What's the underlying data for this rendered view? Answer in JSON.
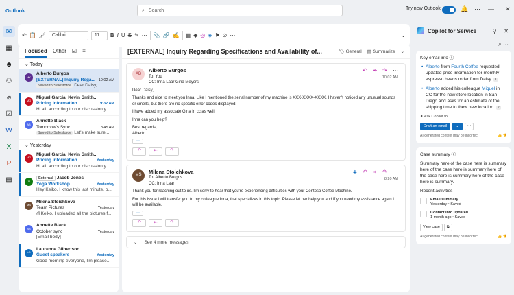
{
  "app": {
    "title": "Outlook"
  },
  "search": {
    "placeholder": "Search"
  },
  "titlebar": {
    "try_new": "Try new Outlook"
  },
  "ribbon": {
    "font": "Calibri",
    "size": "11"
  },
  "list": {
    "tabs": {
      "focused": "Focused",
      "other": "Other"
    },
    "groups": {
      "today": "Today",
      "yesterday": "Yesterday"
    },
    "items": [
      {
        "sender": "Alberto Burgos",
        "subject": "[EXTERNAL] Inquiry Rega...",
        "time": "10:02 AM",
        "chip": "Saved to Salesforce",
        "preview": "Dear Daisy,...",
        "initials": "MK",
        "color": "#5b2e91"
      },
      {
        "sender": "Miguel Garcia, Kevin Smith..",
        "subject": "Pricing information",
        "time": "9:32 AM",
        "preview": "Hi all, according to our discussion y...",
        "initials": "MG",
        "color": "#c50f1f"
      },
      {
        "sender": "Annette Black",
        "subject": "Tomorrow's Sync",
        "time": "8:45 AM",
        "chip": "Saved to Salesforce",
        "preview": "Let's make sure...",
        "initials": "AB",
        "color": "#4f6bed"
      },
      {
        "sender": "Miguel Garcia, Kevin Smith..",
        "subject": "Pricing information",
        "time": "Yesterday",
        "preview": "Hi all, according to our discussion y...",
        "initials": "MG",
        "color": "#c50f1f"
      },
      {
        "sender": "Jacob Jones",
        "chip": "External",
        "subject": "Yoga Workshop",
        "time": "Yesterday",
        "preview": "Hey Keiko, I know this last minute, b...",
        "initials": "JJ",
        "color": "#107c10"
      },
      {
        "sender": "Milena Stoichkova",
        "subject": "Team Pictures",
        "time": "Yesterday",
        "preview": "@Keiko, I uploaded all the pictures f...",
        "initials": "MS",
        "color": "#6e4b32"
      },
      {
        "sender": "Annette Black",
        "subject": "October sync",
        "time": "Yesterday",
        "preview": "[Email body]",
        "initials": "AB",
        "color": "#4f6bed"
      },
      {
        "sender": "Laurence Gilbertson",
        "subject": "Guest speakers",
        "time": "Yesterday",
        "preview": "Good morning everyone, I'm please...",
        "initials": "LG",
        "color": "#0f6cbd"
      }
    ]
  },
  "reading": {
    "subject": "[EXTERNAL] Inquiry Regarding Specifications and Availability of...",
    "tag": "General",
    "summarize": "Summarize",
    "msg1": {
      "initials": "AB",
      "from": "Alberto Burgos",
      "to": "To: You",
      "cc": "CC: Inna Laar  Gina Meyers",
      "date": "10:02 AM",
      "greeting": "Dear Daisy,",
      "p1": "Thanks and nice to meet you Inna. Like I mentioned the serial number of my machine is XXX-XXXX-XXXX. I haven't noticed any unusual sounds or smells, but there are no specific error codes displayed.",
      "p2": "I have added my associate Gina in cc as well.",
      "p3": "Inna can you help?",
      "sign1": "Best regards,",
      "sign2": "Alberto"
    },
    "msg2": {
      "from": "Milena Stoichkova",
      "to": "To: Alberto Burgos",
      "cc": "CC: Inna Laar",
      "date": "8:20 AM",
      "p1": "Thank you for reaching out to us. I'm sorry to hear that you're experiencing difficulties with your Contoso Coffee Machine.",
      "p2": "For this issue I will transfer you to my colleague Inna, that specializes in this topic. Please let her help you and if you need my assistance again I will be available."
    },
    "see_more": "See 4 more messages"
  },
  "copilot": {
    "title": "Copilot for Service",
    "key_info": "Key email info",
    "bullet1": {
      "name": "Alberto",
      "mid": " from ",
      "company": "Fourth Coffee",
      "rest": " requested updated price information for monthly espresso beans order from Daisy."
    },
    "bullet2": {
      "name": "Alberto",
      "mid": " added his colleague ",
      "colleague": "Miguel",
      "rest": " in CC for the new store location in San Diego and asks for an estimate of the shipping time to thew new location."
    },
    "ask": "Ask Copilot to...",
    "draft": "Draft an email",
    "disclaimer": "AI-generated content may be incorrect",
    "case_title": "Case summary",
    "case_text": "Summary here of the case here is summary here of the case here is summary here of the case here is summary here of the case here is summary.",
    "recent": "Recent activities",
    "act1": {
      "title": "Email summary",
      "sub": "Yesterday • Saved"
    },
    "act2": {
      "title": "Contact info updated",
      "sub": "1 month ago • Saved"
    },
    "view_case": "View case"
  }
}
